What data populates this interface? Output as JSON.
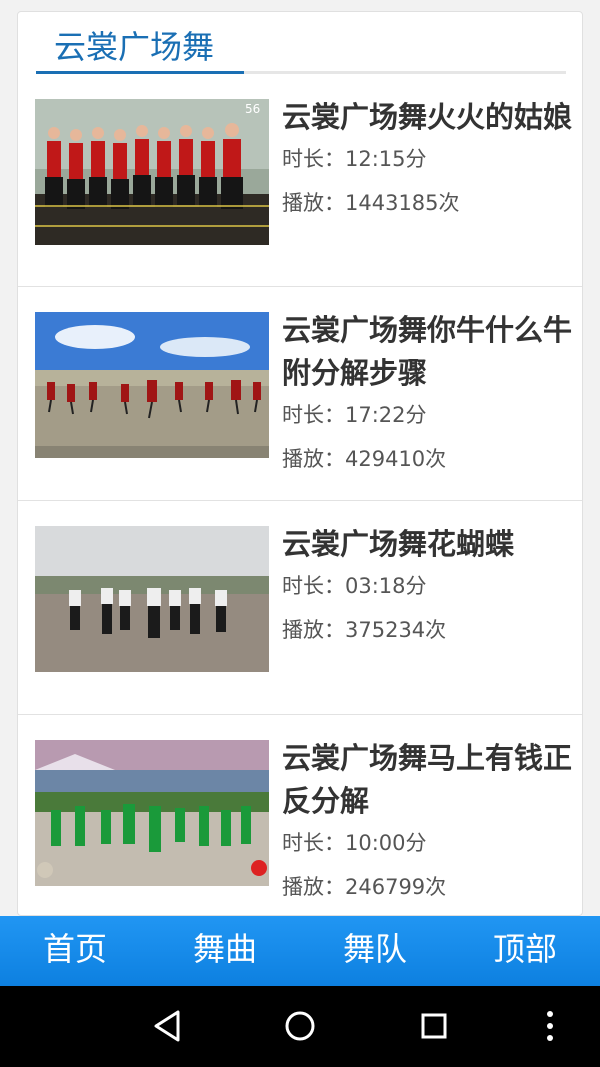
{
  "header": {
    "title": "云裳广场舞"
  },
  "videos": [
    {
      "title": "云裳广场舞火火的姑娘",
      "duration": "时长：12:15分",
      "plays": "播放：1443185次",
      "thumb_label": "56"
    },
    {
      "title": "云裳广场舞你牛什么牛 附分解步骤",
      "duration": "时长：17:22分",
      "plays": "播放：429410次"
    },
    {
      "title": "云裳广场舞花蝴蝶",
      "duration": "时长：03:18分",
      "plays": "播放：375234次"
    },
    {
      "title": "云裳广场舞马上有钱正反分解",
      "duration": "时长：10:00分",
      "plays": "播放：246799次"
    }
  ],
  "tabbar": {
    "home": "首页",
    "songs": "舞曲",
    "teams": "舞队",
    "top": "顶部"
  },
  "icons": {
    "back": "back-triangle-icon",
    "home": "home-circle-icon",
    "recents": "recents-square-icon",
    "menu": "overflow-dots-icon"
  },
  "colors": {
    "accent": "#1a6fb4",
    "tabbar": "#1a8ae8"
  }
}
